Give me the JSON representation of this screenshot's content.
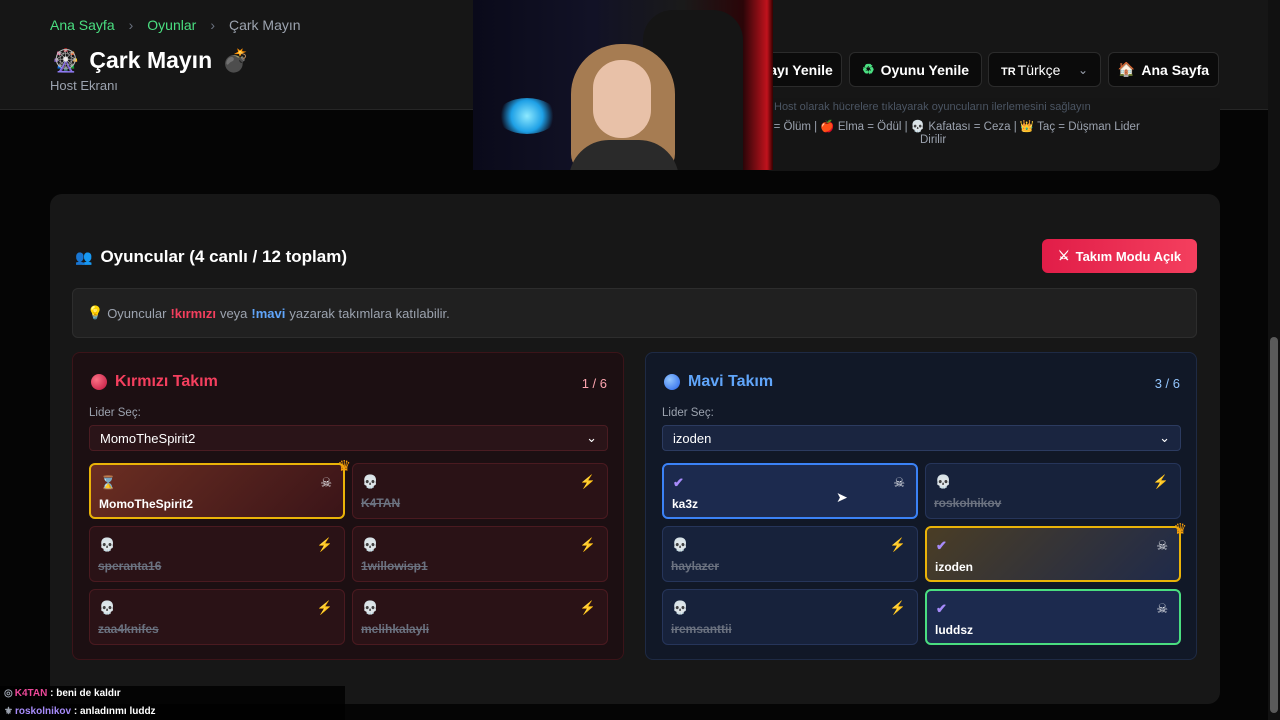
{
  "header": {
    "breadcrumb": [
      "Ana Sayfa",
      "Oyunlar",
      "Çark Mayın"
    ],
    "title": "Çark Mayın",
    "title_icon": "ferris-wheel-icon",
    "bomb_icon": "bomb-icon",
    "subtitle": "Host Ekranı",
    "buttons": {
      "reset_partial": "ayı Yenile",
      "reset_game": "Oyunu Yenile",
      "language_code": "TR",
      "language": "Türkçe",
      "home": "Ana Sayfa"
    },
    "info_faded": "Host olarak hücrelere tıklayarak oyuncuların ilerlemesini sağlayın",
    "info_line": "n = Ölüm | 🍎 Elma = Ödül | 💀 Kafatası = Ceza | 👑 Taç = Düşman Lider",
    "info_line2": "Dirilir"
  },
  "players": {
    "title": "Oyuncular (4 canlı / 12 toplam)",
    "team_mode_button": "Takım Modu Açık",
    "hint": {
      "prefix": "Oyuncular",
      "red_cmd": "!kırmızı",
      "middle": "veya",
      "blue_cmd": "!mavi",
      "suffix": "yazarak takımlara katılabilir."
    }
  },
  "teams": {
    "red": {
      "name": "Kırmızı Takım",
      "count": "1 / 6",
      "leader_label": "Lider Seç:",
      "leader_selected": "MomoTheSpirit2",
      "players": [
        {
          "name": "MomoTheSpirit2",
          "status": "hourglass",
          "alive": true,
          "leader": true
        },
        {
          "name": "K4TAN",
          "status": "skull",
          "alive": false,
          "leader": false
        },
        {
          "name": "speranta16",
          "status": "skull",
          "alive": false,
          "leader": false
        },
        {
          "name": "1willowisp1",
          "status": "skull",
          "alive": false,
          "leader": false
        },
        {
          "name": "zaa4knifes",
          "status": "skull",
          "alive": false,
          "leader": false
        },
        {
          "name": "melihkalayli",
          "status": "skull",
          "alive": false,
          "leader": false
        }
      ]
    },
    "blue": {
      "name": "Mavi Takım",
      "count": "3 / 6",
      "leader_label": "Lider Seç:",
      "leader_selected": "izoden",
      "players": [
        {
          "name": "ka3z",
          "status": "check",
          "alive": true,
          "leader": false
        },
        {
          "name": "roskolnikov",
          "status": "skull",
          "alive": false,
          "leader": false
        },
        {
          "name": "haylazer",
          "status": "skull",
          "alive": false,
          "leader": false
        },
        {
          "name": "izoden",
          "status": "check",
          "alive": true,
          "leader": true
        },
        {
          "name": "iremsanttii",
          "status": "skull",
          "alive": false,
          "leader": false
        },
        {
          "name": "luddsz",
          "status": "check",
          "alive": true,
          "leader": false
        }
      ]
    }
  },
  "chat": [
    {
      "user": "K4TAN",
      "message": ": beni de kaldır"
    },
    {
      "user": "roskolnikov",
      "message": ": anladınmı luddz"
    }
  ],
  "colors": {
    "accent_green": "#4ade80",
    "red_team": "#f43f5e",
    "blue_team": "#60a5fa",
    "leader_border": "#eab308"
  }
}
